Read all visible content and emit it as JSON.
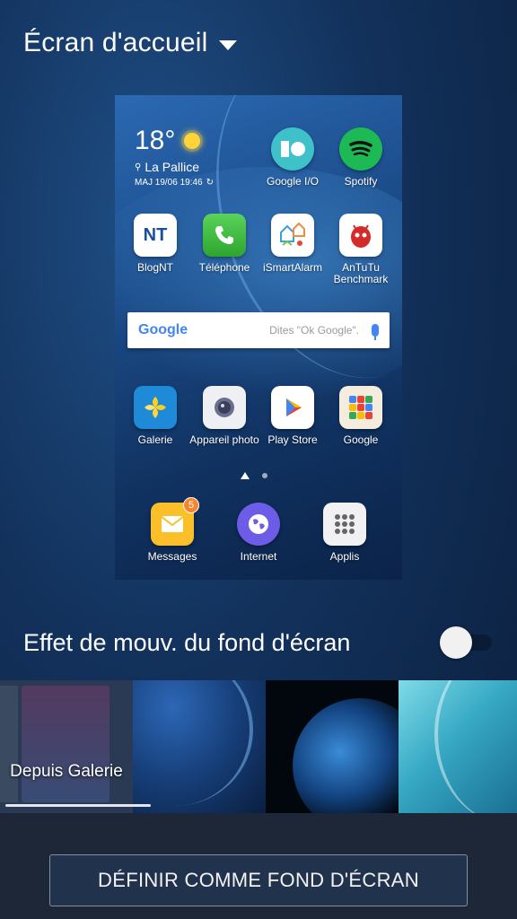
{
  "header": {
    "title": "Écran d'accueil"
  },
  "preview": {
    "weather": {
      "temperature": "18°",
      "location": "La Pallice",
      "updated": "MAJ 19/06 19:46"
    },
    "apps_row1": [
      {
        "label": "Google I/O",
        "icon": "google-io-icon"
      },
      {
        "label": "Spotify",
        "icon": "spotify-icon"
      }
    ],
    "apps_row2": [
      {
        "label": "BlogNT",
        "icon": "blognt-icon"
      },
      {
        "label": "Téléphone",
        "icon": "phone-icon"
      },
      {
        "label": "iSmartAlarm",
        "icon": "ismartalarm-icon"
      },
      {
        "label": "AnTuTu Benchmark",
        "icon": "antutu-icon"
      }
    ],
    "search": {
      "logo": "Google",
      "placeholder": "Dites \"Ok Google\"."
    },
    "apps_row3": [
      {
        "label": "Galerie",
        "icon": "gallery-icon"
      },
      {
        "label": "Appareil photo",
        "icon": "camera-icon"
      },
      {
        "label": "Play Store",
        "icon": "play-store-icon"
      },
      {
        "label": "Google",
        "icon": "google-folder-icon"
      }
    ],
    "dock": [
      {
        "label": "Messages",
        "icon": "messages-icon",
        "badge": "5"
      },
      {
        "label": "Internet",
        "icon": "internet-icon"
      },
      {
        "label": "Applis",
        "icon": "apps-grid-icon"
      }
    ]
  },
  "motion_effect": {
    "label": "Effet de mouv. du fond d'écran",
    "enabled": false
  },
  "wallpapers": {
    "gallery_label": "Depuis Galerie"
  },
  "action": {
    "set_button": "DÉFINIR COMME FOND D'ÉCRAN"
  },
  "colors": {
    "accent_orange": "#f5862b",
    "spotify_green": "#1db954"
  }
}
